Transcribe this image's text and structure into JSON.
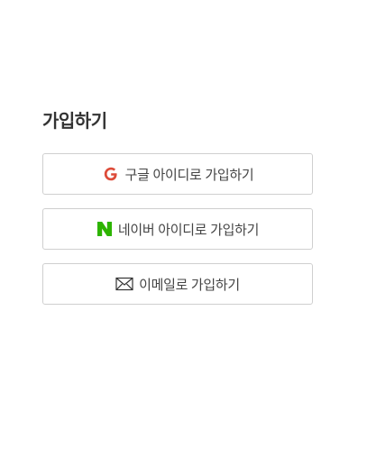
{
  "signup": {
    "title": "가입하기",
    "buttons": [
      {
        "label": "구글 아이디로 가입하기",
        "icon": "google-g-icon",
        "icon_color": "#dd4b39"
      },
      {
        "label": "네이버 아이디로 가입하기",
        "icon": "naver-n-icon",
        "icon_color": "#2db400"
      },
      {
        "label": "이메일로 가입하기",
        "icon": "envelope-icon",
        "icon_color": "#333333"
      }
    ]
  }
}
